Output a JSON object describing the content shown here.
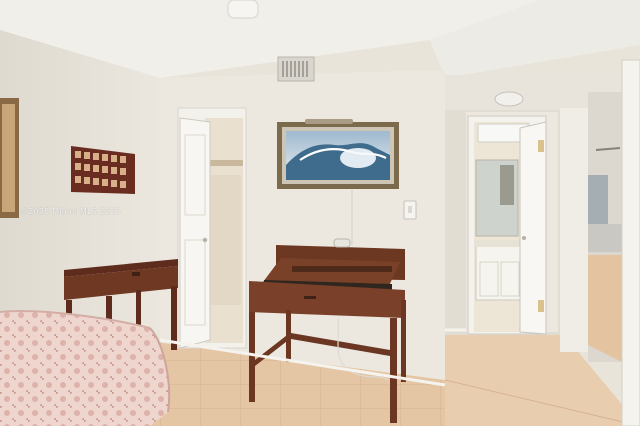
{
  "photo": {
    "watermark": "©2025 Miami MLS 2025"
  },
  "colors": {
    "wall": "#ebe7df",
    "ceiling": "#f2f0ea",
    "floor_tile": "#e6c9a8",
    "wood": "#6e3a24",
    "bedspread": "#e9cfc8"
  }
}
